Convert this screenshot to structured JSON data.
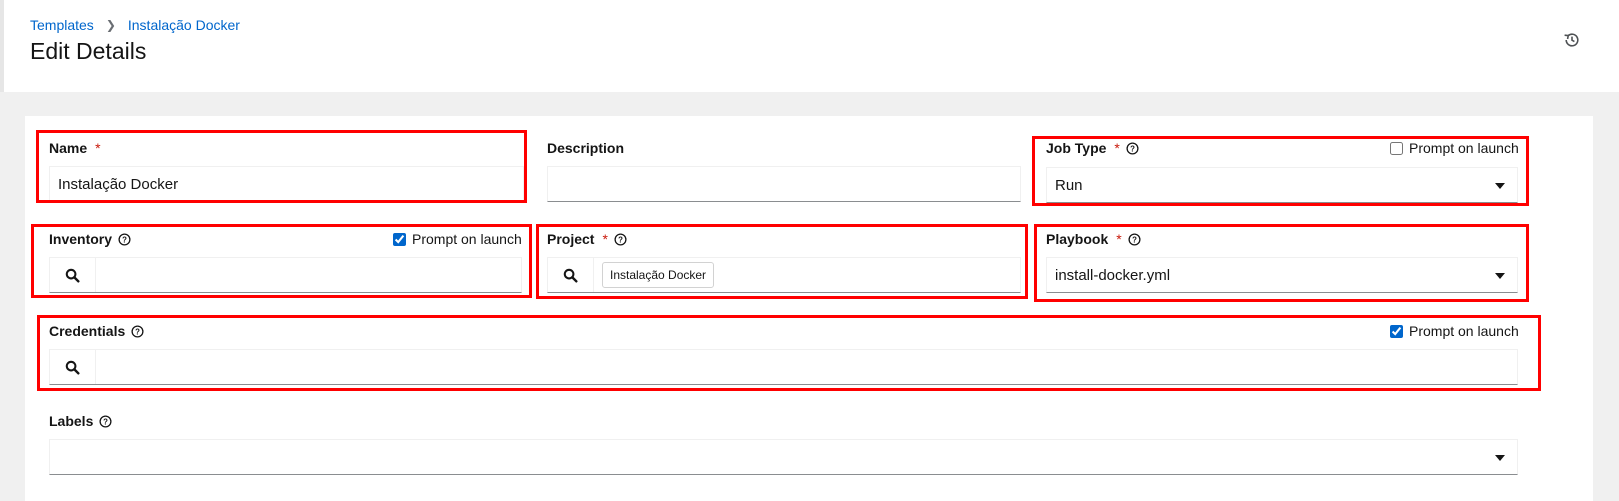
{
  "breadcrumb": {
    "items": [
      "Templates",
      "Instalação Docker"
    ]
  },
  "header": {
    "title": "Edit Details"
  },
  "form": {
    "name": {
      "label": "Name",
      "required_mark": "*",
      "value": "Instalação Docker"
    },
    "description": {
      "label": "Description",
      "value": ""
    },
    "job_type": {
      "label": "Job Type",
      "required_mark": "*",
      "value": "Run",
      "prompt_label": "Prompt on launch",
      "prompt_checked": false
    },
    "inventory": {
      "label": "Inventory",
      "value": "",
      "prompt_label": "Prompt on launch",
      "prompt_checked": true
    },
    "project": {
      "label": "Project",
      "required_mark": "*",
      "chip": "Instalação Docker"
    },
    "playbook": {
      "label": "Playbook",
      "required_mark": "*",
      "value": "install-docker.yml"
    },
    "credentials": {
      "label": "Credentials",
      "value": "",
      "prompt_label": "Prompt on launch",
      "prompt_checked": true
    },
    "labels": {
      "label": "Labels",
      "value": ""
    }
  },
  "icons": {
    "history": "history-icon",
    "help": "question-circle-icon",
    "search": "search-icon",
    "caret": "caret-down-icon",
    "separator": "angle-right-icon"
  },
  "colors": {
    "link": "#0066cc",
    "required": "#c9190b",
    "highlight": "#ff0000"
  }
}
